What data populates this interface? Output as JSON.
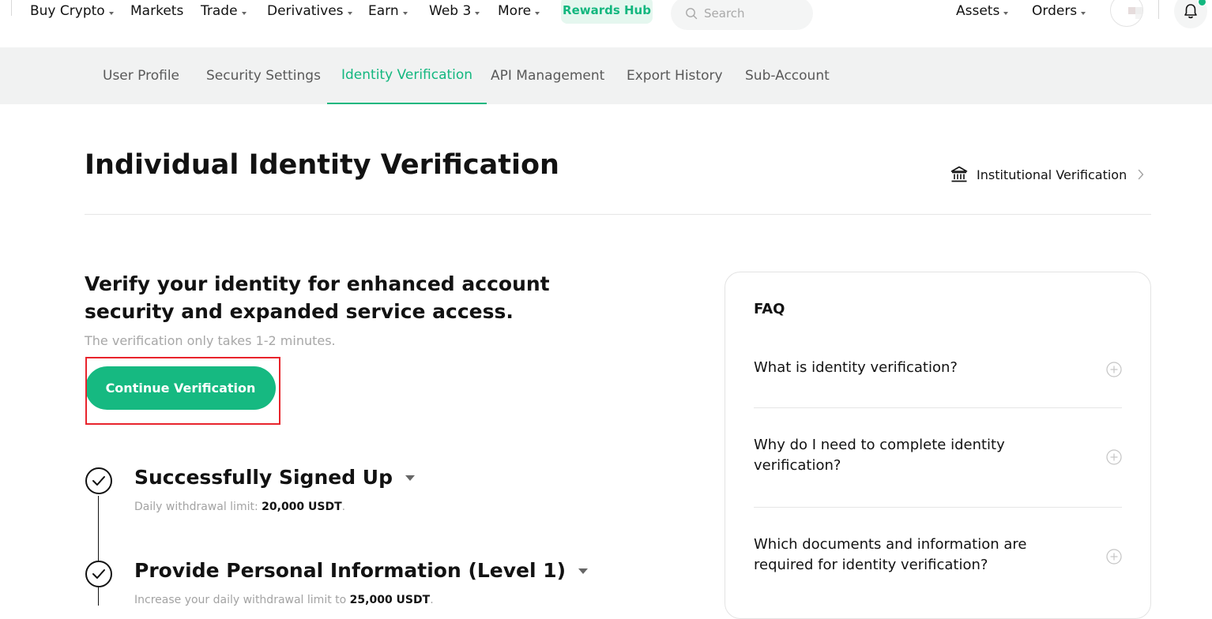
{
  "topnav": {
    "items": [
      {
        "label": "Buy Crypto",
        "caret": true
      },
      {
        "label": "Markets",
        "caret": false
      },
      {
        "label": "Trade",
        "caret": true
      },
      {
        "label": "Derivatives",
        "caret": true
      },
      {
        "label": "Earn",
        "caret": true
      },
      {
        "label": "Web 3",
        "caret": true
      },
      {
        "label": "More",
        "caret": true
      }
    ],
    "rewards_label": "Rewards Hub",
    "search_placeholder": "Search",
    "assets_label": "Assets",
    "orders_label": "Orders"
  },
  "subnav": {
    "tabs": [
      {
        "label": "User Profile",
        "active": false
      },
      {
        "label": "Security Settings",
        "active": false
      },
      {
        "label": "Identity Verification",
        "active": true
      },
      {
        "label": "API Management",
        "active": false
      },
      {
        "label": "Export History",
        "active": false
      },
      {
        "label": "Sub-Account",
        "active": false
      }
    ]
  },
  "page": {
    "title": "Individual Identity Verification",
    "institutional_link": "Institutional Verification"
  },
  "intro": {
    "heading": "Verify your identity for enhanced account security and expanded service access.",
    "subtext": "The verification only takes 1-2 minutes.",
    "cta_label": "Continue Verification"
  },
  "steps": [
    {
      "title": "Successfully Signed Up",
      "desc_prefix": "Daily withdrawal limit: ",
      "desc_value": "20,000 USDT",
      "desc_suffix": "."
    },
    {
      "title": "Provide Personal Information (Level 1)",
      "desc_prefix": "Increase your daily withdrawal limit to ",
      "desc_value": "25,000 USDT",
      "desc_suffix": "."
    }
  ],
  "faq": {
    "title": "FAQ",
    "items": [
      {
        "question": "What is identity verification?"
      },
      {
        "question": "Why do I need to complete identity verification?"
      },
      {
        "question": "Which documents and information are required for identity verification?"
      }
    ]
  },
  "colors": {
    "accent": "#13b77f",
    "cta": "#16b981",
    "highlight": "#e8242c",
    "subnav_bg": "#f1f2f2"
  },
  "icons": [
    "search-icon",
    "bell-icon",
    "bank-icon",
    "chevron-right-icon",
    "check-icon",
    "plus-circle-icon",
    "caret-down-icon"
  ]
}
